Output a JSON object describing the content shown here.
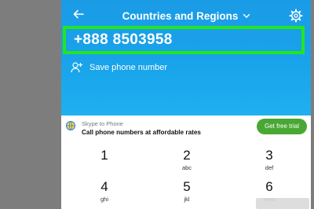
{
  "header": {
    "title": "Countries and Regions",
    "back_icon": "back-arrow-icon",
    "dropdown_icon": "chevron-down-icon",
    "settings_icon": "gear-icon"
  },
  "dial": {
    "phone_number": "+888 8503958",
    "highlight_color": "#22e61e"
  },
  "save": {
    "label": "Save phone number",
    "icon": "add-person-icon"
  },
  "promo": {
    "title": "Skype to Phone",
    "subtitle": "Call phone numbers at affordable rates",
    "button_label": "Get free trial",
    "icon": "globe-phone-icon",
    "button_color": "#48a833"
  },
  "keypad": {
    "keys": [
      {
        "digit": "1",
        "letters": ""
      },
      {
        "digit": "2",
        "letters": "abc"
      },
      {
        "digit": "3",
        "letters": "def"
      },
      {
        "digit": "4",
        "letters": "ghi"
      },
      {
        "digit": "5",
        "letters": "jkl"
      },
      {
        "digit": "6",
        "letters": "mno"
      }
    ]
  },
  "colors": {
    "accent_blue": "#1a9be6",
    "side_gray": "#7d7d7d"
  }
}
